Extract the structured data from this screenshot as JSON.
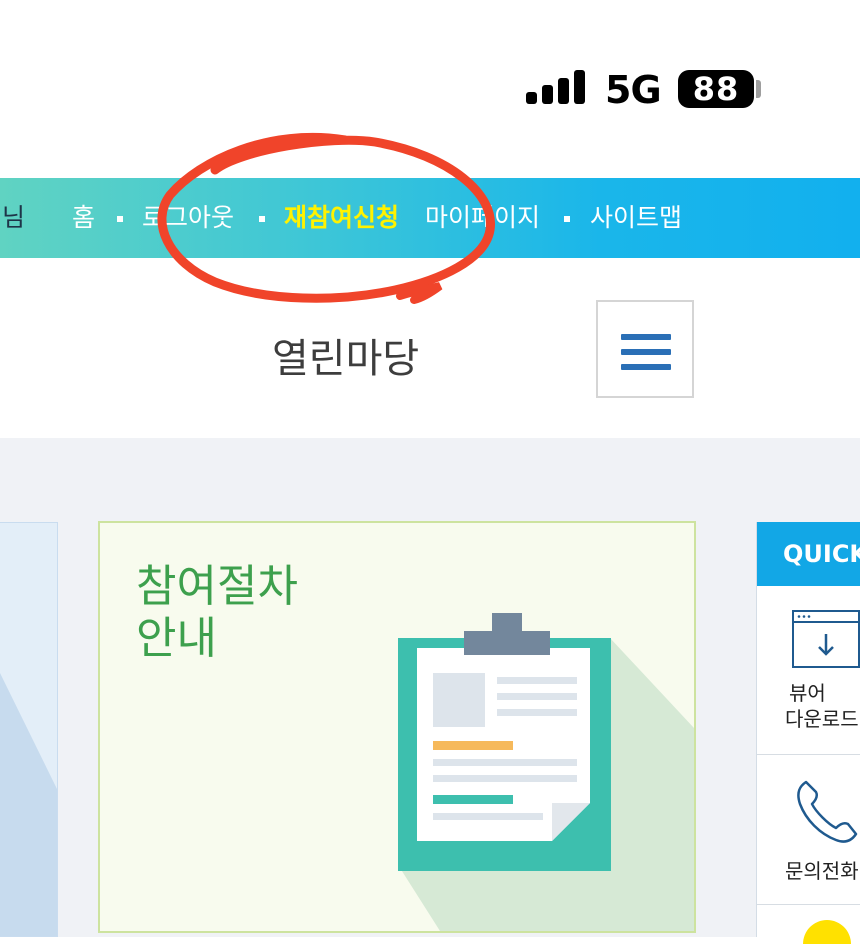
{
  "status_bar": {
    "network": "5G",
    "battery": "88"
  },
  "topnav": {
    "user_suffix": "님",
    "items": [
      {
        "label": "홈"
      },
      {
        "label": "로그아웃"
      },
      {
        "label": "재참여신청"
      },
      {
        "label": "마이페이지"
      },
      {
        "label": "사이트맵"
      }
    ],
    "gradient_start": "#60d3c2",
    "gradient_end": "#12b0ee",
    "active_color": "#fff200"
  },
  "header": {
    "title": "열린마당"
  },
  "main_card": {
    "title_line1": "참여절차",
    "title_line2": "안내"
  },
  "quick": {
    "heading": "QUICK",
    "items": [
      {
        "label_line1": "뷰어",
        "label_line2": "다운로드",
        "icon": "download-window-icon"
      },
      {
        "label_line1": "문의전화",
        "icon": "phone-icon"
      }
    ]
  },
  "annotation": {
    "color": "#f0442a"
  }
}
